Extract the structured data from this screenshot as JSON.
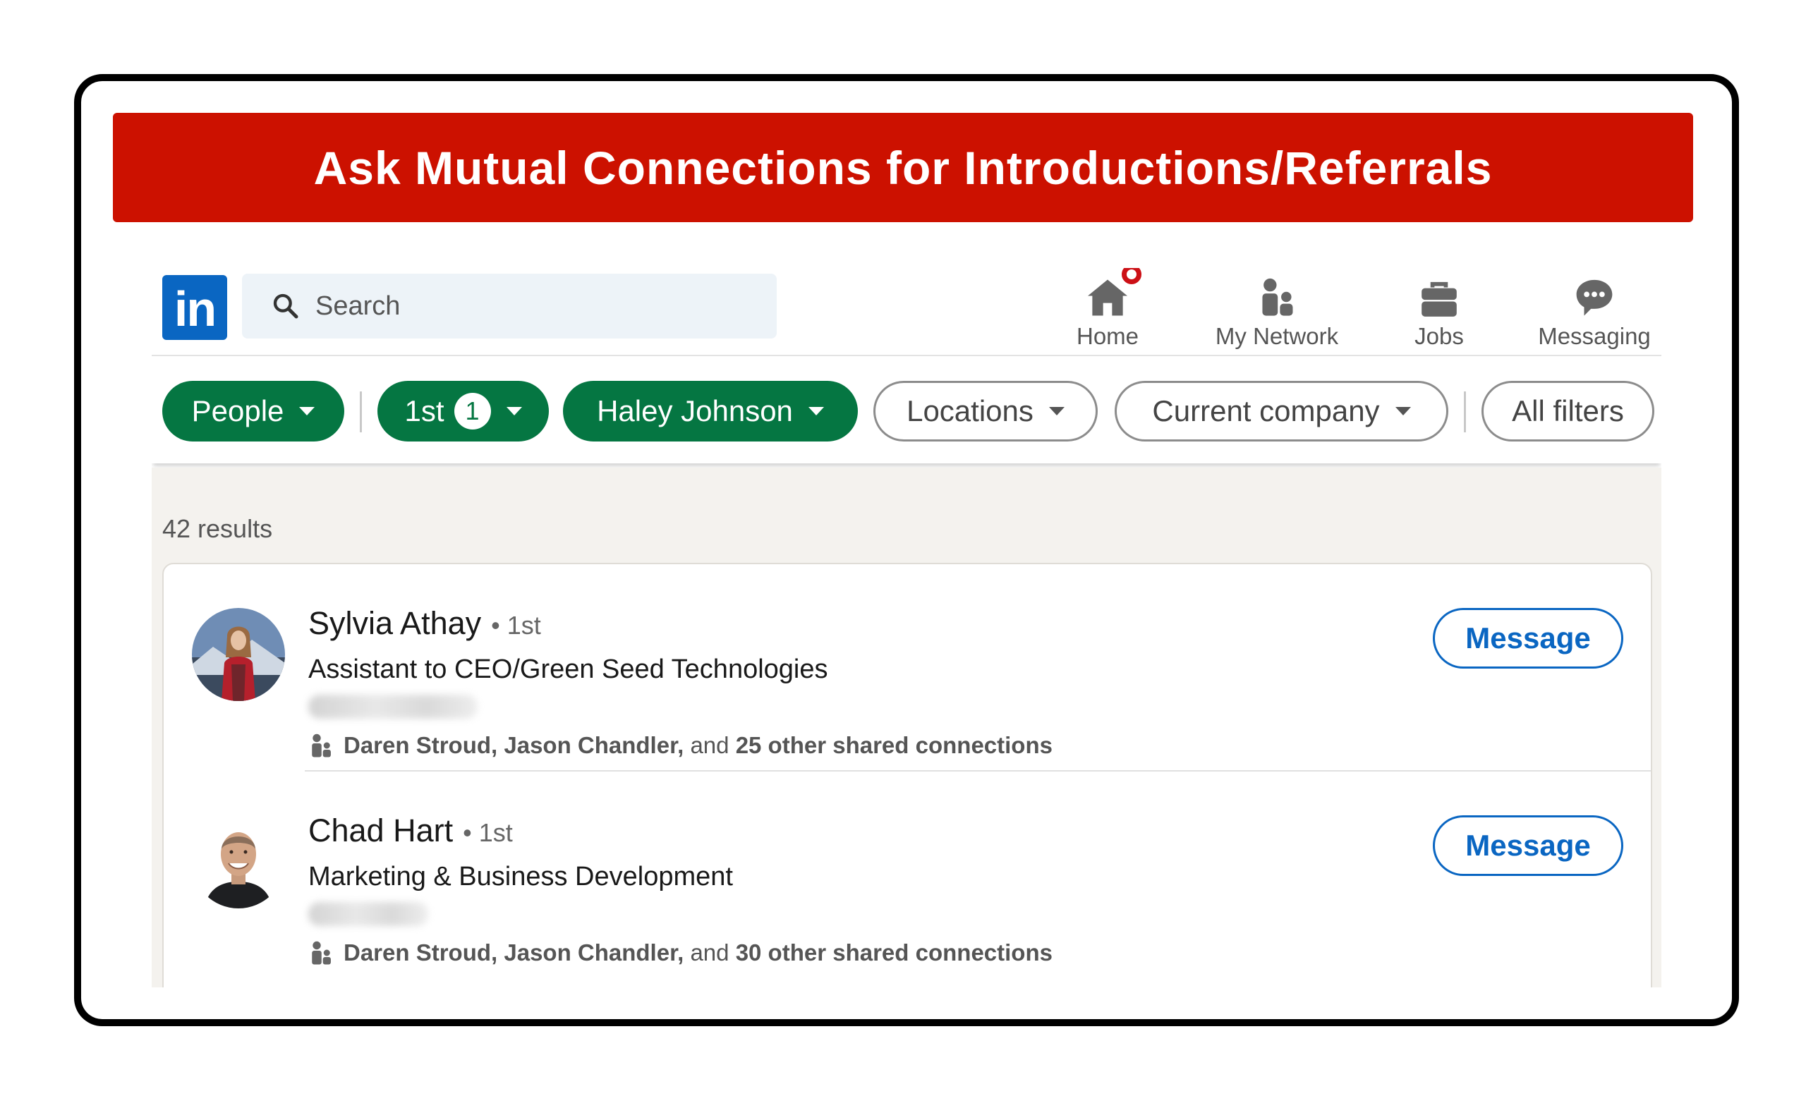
{
  "banner": {
    "title": "Ask Mutual Connections for Introductions/Referrals"
  },
  "colors": {
    "banner": "#cc1100",
    "linkedin_blue": "#0a66c2",
    "filter_active": "#057642"
  },
  "logo": {
    "text": "in"
  },
  "search": {
    "placeholder": "Search",
    "icon": "search-icon"
  },
  "nav": [
    {
      "label": "Home",
      "icon": "home-icon",
      "has_badge": true
    },
    {
      "label": "My Network",
      "icon": "network-icon"
    },
    {
      "label": "Jobs",
      "icon": "briefcase-icon"
    },
    {
      "label": "Messaging",
      "icon": "messaging-icon"
    }
  ],
  "filters": {
    "people": "People",
    "connections": "1st",
    "connections_count": "1",
    "connection_of": "Haley Johnson",
    "locations": "Locations",
    "current_company": "Current company",
    "all_filters": "All filters"
  },
  "results": {
    "count_text": "42 results",
    "items": [
      {
        "name": "Sylvia Athay",
        "degree": "• 1st",
        "headline": "Assistant to CEO/Green Seed Technologies",
        "shared_names": "Daren Stroud, Jason Chandler,",
        "shared_and": "and",
        "shared_rest": "25 other shared connections",
        "button": "Message"
      },
      {
        "name": "Chad Hart",
        "degree": "• 1st",
        "headline": "Marketing & Business Development",
        "shared_names": "Daren Stroud, Jason Chandler,",
        "shared_and": "and",
        "shared_rest": "30 other shared connections",
        "button": "Message"
      }
    ]
  }
}
